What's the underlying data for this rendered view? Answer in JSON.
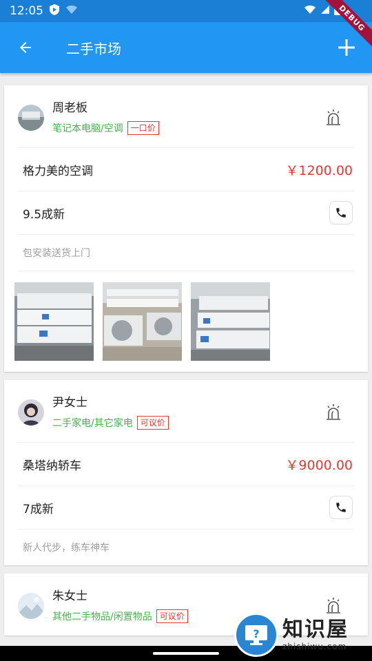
{
  "status_bar": {
    "time": "12:05"
  },
  "app_bar": {
    "title": "二手市场"
  },
  "debug_banner": "DEBUG",
  "listings": [
    {
      "user_name": "周老板",
      "category": "笔记本电脑/空调",
      "price_tag": "一口价",
      "item_name": "格力美的空调",
      "price": "￥1200.00",
      "condition": "9.5成新",
      "description": "包安装送货上门",
      "avatar_icon": "person-photo-avatar",
      "photos": [
        "air-conditioner-photo",
        "air-conditioner-units-photo",
        "air-conditioner-stack-photo"
      ]
    },
    {
      "user_name": "尹女士",
      "category": "二手家电/其它家电",
      "price_tag": "可议价",
      "item_name": "桑塔纳轿车",
      "price": "￥9000.00",
      "condition": "7成新",
      "description": "新人代步，练车神车",
      "avatar_icon": "person-photo-avatar"
    },
    {
      "user_name": "朱女士",
      "category": "其他二手物品/闲置物品",
      "price_tag": "可议价",
      "avatar_icon": "landscape-avatar"
    }
  ],
  "watermark": {
    "title": "知识屋",
    "url": "zhishiwu.com"
  },
  "colors": {
    "app_bar": "#2196f3",
    "status_bar": "#1c7fd6",
    "price": "#e53935",
    "category": "#4caf50"
  }
}
